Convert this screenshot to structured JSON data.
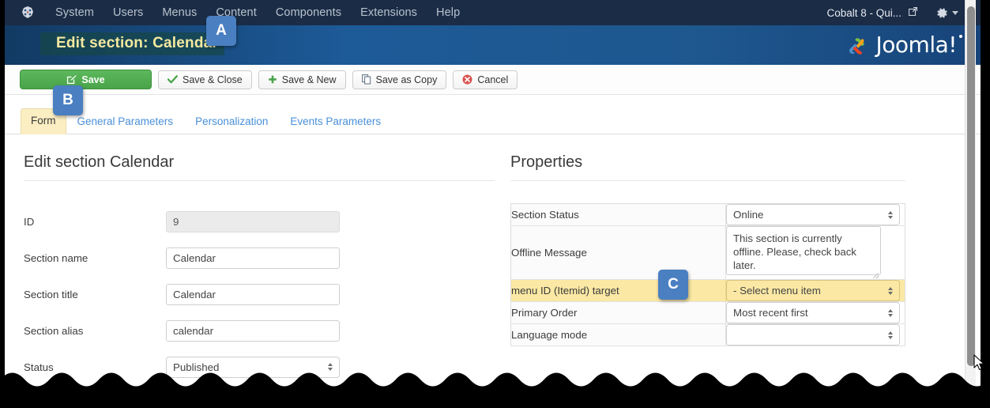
{
  "topbar": {
    "brand_icon": "joomla-brand-icon",
    "nav": [
      {
        "label": "System"
      },
      {
        "label": "Users"
      },
      {
        "label": "Menus"
      },
      {
        "label": "Content"
      },
      {
        "label": "Components"
      },
      {
        "label": "Extensions"
      },
      {
        "label": "Help"
      }
    ],
    "site_name": "Cobalt 8 - Qui...",
    "external_link_icon": "external-link-icon",
    "gear_icon": "gear-icon",
    "caret_icon": "chevron-down-icon"
  },
  "subheader": {
    "page_title": "Edit section: Calendar",
    "logo_text": "Joomla!",
    "logo_mark": "joomla-logo-mark"
  },
  "toolbar": {
    "save_label": "Save",
    "save_close_label": "Save & Close",
    "save_new_label": "Save & New",
    "save_copy_label": "Save as Copy",
    "cancel_label": "Cancel",
    "save_icon": "edit-square-icon",
    "check_icon": "check-icon",
    "plus_icon": "plus-icon",
    "copy_icon": "copy-icon",
    "cancel_icon": "cancel-circle-icon"
  },
  "tabs": [
    {
      "label": "Form",
      "active": true
    },
    {
      "label": "General Parameters",
      "active": false
    },
    {
      "label": "Personalization",
      "active": false
    },
    {
      "label": "Events Parameters",
      "active": false
    }
  ],
  "left_panel": {
    "heading": "Edit section Calendar",
    "fields": [
      {
        "label": "ID",
        "value": "9",
        "type": "text-readonly"
      },
      {
        "label": "Section name",
        "value": "Calendar",
        "type": "text"
      },
      {
        "label": "Section title",
        "value": "Calendar",
        "type": "text"
      },
      {
        "label": "Section alias",
        "value": "calendar",
        "type": "text"
      },
      {
        "label": "Status",
        "value": "Published",
        "type": "select"
      }
    ]
  },
  "right_panel": {
    "heading": "Properties",
    "rows": [
      {
        "label": "Section Status",
        "value": "Online",
        "type": "select",
        "highlight": false
      },
      {
        "label": "Offline Message",
        "value": "This section is currently offline. Please, check back later.",
        "type": "textarea",
        "highlight": false
      },
      {
        "label": "menu ID (Itemid) target",
        "value": "- Select menu item",
        "type": "select",
        "highlight": true
      },
      {
        "label": "Primary Order",
        "value": "Most recent first",
        "type": "select",
        "highlight": false
      },
      {
        "label": "Language mode",
        "value": "",
        "type": "select",
        "highlight": false
      }
    ]
  },
  "badges": [
    {
      "letter": "A"
    },
    {
      "letter": "B"
    },
    {
      "letter": "C"
    }
  ],
  "colors": {
    "topbar_bg": "#1b2c46",
    "subheader_blue": "#1d5a98",
    "title_yellow": "#f5e9a0",
    "badge_blue": "#4a7fc1",
    "save_green": "#5cb85c",
    "tab_active_bg": "#fbeec3",
    "highlight_row": "#fae8a4",
    "link_blue": "#4a90d9"
  },
  "scrollbar": {
    "thumb": "vertical-scroll-thumb"
  },
  "cursor": {
    "icon": "mouse-pointer-icon"
  }
}
